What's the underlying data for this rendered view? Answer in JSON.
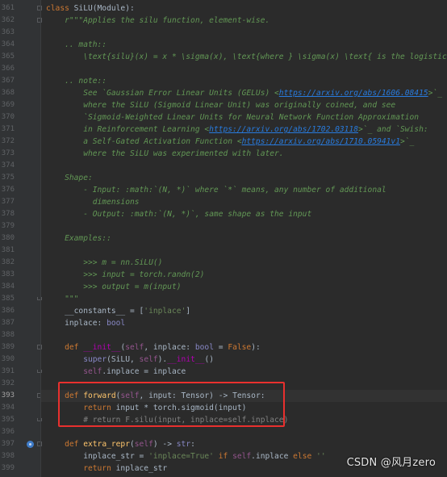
{
  "editor": {
    "current_line": 393,
    "highlight_note": "",
    "lines": [
      {
        "n": 361,
        "tokens": [
          [
            "kw",
            "class "
          ],
          [
            "plain",
            "SiLU(Module):"
          ]
        ]
      },
      {
        "n": 362,
        "tokens": [
          [
            "doc",
            "    r\"\"\"Applies the silu function, element-wise."
          ]
        ]
      },
      {
        "n": 363,
        "tokens": []
      },
      {
        "n": 364,
        "tokens": [
          [
            "doc",
            "    .. math::"
          ]
        ]
      },
      {
        "n": 365,
        "tokens": [
          [
            "doc",
            "        \\text{silu}(x) = x * \\sigma(x), \\text{where } \\sigma(x) \\text{ is the logistic sigmoid.}"
          ]
        ]
      },
      {
        "n": 366,
        "tokens": []
      },
      {
        "n": 367,
        "tokens": [
          [
            "doc",
            "    .. note::"
          ]
        ]
      },
      {
        "n": 368,
        "tokens": [
          [
            "doc",
            "        See `Gaussian Error Linear Units (GELUs) <"
          ],
          [
            "link",
            "https://arxiv.org/abs/1606.08415"
          ],
          [
            "doc",
            ">`_"
          ]
        ]
      },
      {
        "n": 369,
        "tokens": [
          [
            "doc",
            "        where the SiLU (Sigmoid Linear Unit) was originally coined, and see"
          ]
        ]
      },
      {
        "n": 370,
        "tokens": [
          [
            "doc",
            "        `Sigmoid-Weighted Linear Units for Neural Network Function Approximation"
          ]
        ]
      },
      {
        "n": 371,
        "tokens": [
          [
            "doc",
            "        in Reinforcement Learning <"
          ],
          [
            "link",
            "https://arxiv.org/abs/1702.03118"
          ],
          [
            "doc",
            ">`_ and `Swish:"
          ]
        ]
      },
      {
        "n": 372,
        "tokens": [
          [
            "doc",
            "        a Self-Gated Activation Function <"
          ],
          [
            "link",
            "https://arxiv.org/abs/1710.05941v1"
          ],
          [
            "doc",
            ">`_"
          ]
        ]
      },
      {
        "n": 373,
        "tokens": [
          [
            "doc",
            "        where the SiLU was experimented with later."
          ]
        ]
      },
      {
        "n": 374,
        "tokens": []
      },
      {
        "n": 375,
        "tokens": [
          [
            "doc",
            "    Shape:"
          ]
        ]
      },
      {
        "n": 376,
        "tokens": [
          [
            "doc",
            "        - Input: :math:`(N, *)` where `*` means, any number of additional"
          ]
        ]
      },
      {
        "n": 377,
        "tokens": [
          [
            "doc",
            "          dimensions"
          ]
        ]
      },
      {
        "n": 378,
        "tokens": [
          [
            "doc",
            "        - Output: :math:`(N, *)`, same shape as the input"
          ]
        ]
      },
      {
        "n": 379,
        "tokens": []
      },
      {
        "n": 380,
        "tokens": [
          [
            "doc",
            "    Examples::"
          ]
        ]
      },
      {
        "n": 381,
        "tokens": []
      },
      {
        "n": 382,
        "tokens": [
          [
            "doc",
            "        >>> m = nn.SiLU()"
          ]
        ]
      },
      {
        "n": 383,
        "tokens": [
          [
            "doc",
            "        >>> input = torch.randn(2)"
          ]
        ]
      },
      {
        "n": 384,
        "tokens": [
          [
            "doc",
            "        >>> output = m(input)"
          ]
        ]
      },
      {
        "n": 385,
        "tokens": [
          [
            "doc",
            "    \"\"\""
          ]
        ]
      },
      {
        "n": 386,
        "tokens": [
          [
            "plain",
            "    __constants__ = ["
          ],
          [
            "str",
            "'inplace'"
          ],
          [
            "plain",
            "]"
          ]
        ]
      },
      {
        "n": 387,
        "tokens": [
          [
            "plain",
            "    inplace: "
          ],
          [
            "builtin",
            "bool"
          ]
        ]
      },
      {
        "n": 388,
        "tokens": []
      },
      {
        "n": 389,
        "tokens": [
          [
            "kw",
            "    def "
          ],
          [
            "dunder",
            "__init__"
          ],
          [
            "plain",
            "("
          ],
          [
            "self",
            "self"
          ],
          [
            "plain",
            ", inplace: "
          ],
          [
            "builtin",
            "bool"
          ],
          [
            "plain",
            " = "
          ],
          [
            "kw",
            "False"
          ],
          [
            "plain",
            "):"
          ]
        ]
      },
      {
        "n": 390,
        "tokens": [
          [
            "plain",
            "        "
          ],
          [
            "builtin",
            "super"
          ],
          [
            "plain",
            "(SiLU, "
          ],
          [
            "self",
            "self"
          ],
          [
            "plain",
            ")."
          ],
          [
            "dunder",
            "__init__"
          ],
          [
            "plain",
            "()"
          ]
        ]
      },
      {
        "n": 391,
        "tokens": [
          [
            "plain",
            "        "
          ],
          [
            "self",
            "self"
          ],
          [
            "plain",
            ".inplace = inplace"
          ]
        ]
      },
      {
        "n": 392,
        "tokens": []
      },
      {
        "n": 393,
        "tokens": [
          [
            "kw",
            "    def "
          ],
          [
            "fn",
            "forward"
          ],
          [
            "plain",
            "("
          ],
          [
            "self",
            "self"
          ],
          [
            "plain",
            ", input: Tensor) -> Tensor:"
          ]
        ]
      },
      {
        "n": 394,
        "tokens": [
          [
            "kw",
            "        return "
          ],
          [
            "plain",
            "input * torch.sigmoid(input)"
          ]
        ]
      },
      {
        "n": 395,
        "tokens": [
          [
            "cmt",
            "        # return F.silu(input, inplace=self.inplace)"
          ]
        ]
      },
      {
        "n": 396,
        "tokens": []
      },
      {
        "n": 397,
        "tokens": [
          [
            "kw",
            "    def "
          ],
          [
            "fn",
            "extra_repr"
          ],
          [
            "plain",
            "("
          ],
          [
            "self",
            "self"
          ],
          [
            "plain",
            ") -> "
          ],
          [
            "builtin",
            "str"
          ],
          [
            "plain",
            ":"
          ]
        ]
      },
      {
        "n": 398,
        "tokens": [
          [
            "plain",
            "        inplace_str = "
          ],
          [
            "str",
            "'inplace=True'"
          ],
          [
            "kw",
            " if "
          ],
          [
            "self",
            "self"
          ],
          [
            "plain",
            ".inplace "
          ],
          [
            "kw",
            "else "
          ],
          [
            "str",
            "''"
          ]
        ]
      },
      {
        "n": 399,
        "tokens": [
          [
            "kw",
            "        return "
          ],
          [
            "plain",
            "inplace_str"
          ]
        ]
      }
    ]
  },
  "watermark": {
    "text": "CSDN @风月zero"
  },
  "colors": {
    "background": "#2b2b2b",
    "gutter": "#313335",
    "keyword": "#cc7832",
    "docstring": "#629755",
    "link": "#287bde",
    "comment": "#808080",
    "self": "#94558d",
    "highlight_border": "#e8302e"
  },
  "icons": {
    "override_marker": "override-icon",
    "fold": "fold-marker-icon"
  }
}
